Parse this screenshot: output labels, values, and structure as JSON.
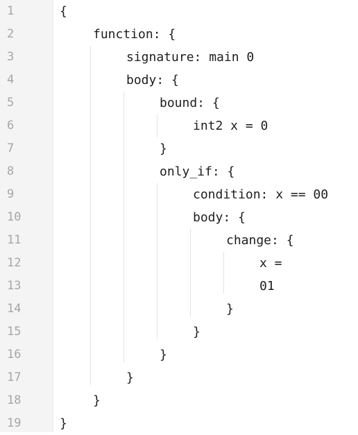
{
  "editor": {
    "line_numbers": [
      "1",
      "2",
      "3",
      "4",
      "5",
      "6",
      "7",
      "8",
      "9",
      "10",
      "11",
      "12",
      "13",
      "14",
      "15",
      "16",
      "17",
      "18",
      "19"
    ],
    "lines": [
      "{",
      "function: {",
      "signature: main 0",
      "body: {",
      "bound: {",
      "int2 x = 0",
      "}",
      "only_if: {",
      "condition: x == 00",
      "body: {",
      "change: {",
      "x =",
      "01",
      "}",
      "}",
      "}",
      "}",
      "}",
      "}"
    ]
  }
}
